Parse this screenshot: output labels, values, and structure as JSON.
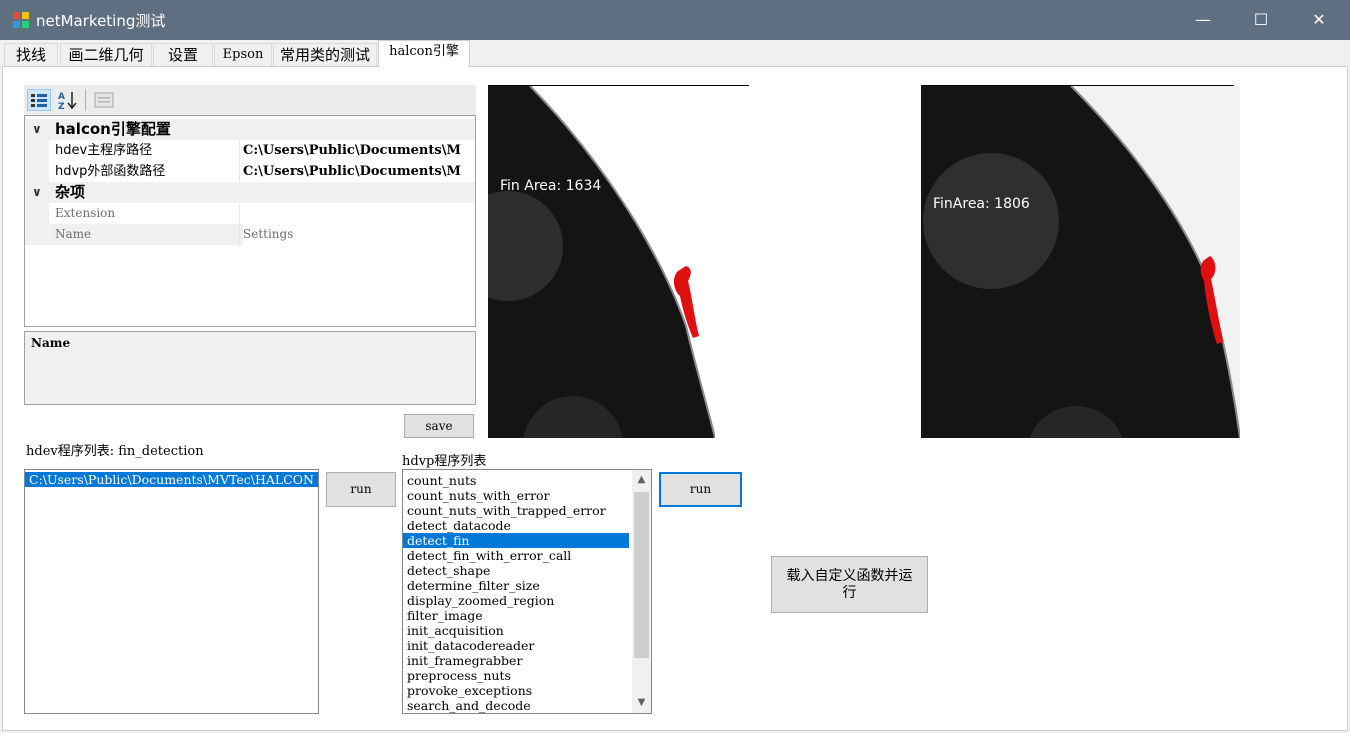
{
  "window": {
    "title": "netMarketing测试",
    "controls": {
      "minimize": "—",
      "maximize": "☐",
      "close": "✕"
    }
  },
  "tabs": [
    {
      "label": "找线"
    },
    {
      "label": "画二维几何"
    },
    {
      "label": "设置"
    },
    {
      "label": "Epson"
    },
    {
      "label": "常用类的测试"
    },
    {
      "label": "halcon引擎",
      "active": true
    }
  ],
  "property_grid": {
    "categories": [
      {
        "label": "halcon引擎配置",
        "rows": [
          {
            "name": "hdev主程序路径",
            "value": "C:\\Users\\Public\\Documents\\M"
          },
          {
            "name": "hdvp外部函数路径",
            "value": "C:\\Users\\Public\\Documents\\M"
          }
        ]
      },
      {
        "label": "杂项",
        "rows": [
          {
            "name": "Extension",
            "value": ""
          },
          {
            "name": "Name",
            "value": "Settings"
          }
        ]
      }
    ],
    "help_title": "Name"
  },
  "save_button": "save",
  "hdev": {
    "label": "hdev程序列表: fin_detection",
    "items": [
      "C:\\Users\\Public\\Documents\\MVTec\\HALCON"
    ],
    "selected_index": 0,
    "run_label": "run"
  },
  "hdvp": {
    "label": "hdvp程序列表",
    "items": [
      "count_nuts",
      "count_nuts_with_error",
      "count_nuts_with_trapped_error",
      "detect_datacode",
      "detect_fin",
      "detect_fin_with_error_call",
      "detect_shape",
      "determine_filter_size",
      "display_zoomed_region",
      "filter_image",
      "init_acquisition",
      "init_datacodereader",
      "init_framegrabber",
      "preprocess_nuts",
      "provoke_exceptions",
      "search_and_decode"
    ],
    "selected_index": 4,
    "run_label": "run"
  },
  "custom_button": {
    "line1": "载入自定义函数并运",
    "line2": "行"
  },
  "images": [
    {
      "caption": "Fin Area: 1634"
    },
    {
      "caption": "FinArea: 1806"
    }
  ],
  "colors": {
    "titlebar": "#5f6f82",
    "selection": "#0078d7",
    "fin": "#e01010"
  }
}
